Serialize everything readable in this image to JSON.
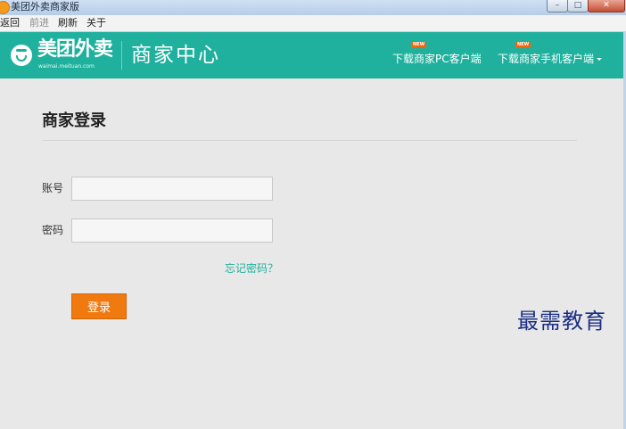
{
  "window": {
    "title": "美团外卖商家版",
    "controls": {
      "minimize": "–",
      "maximize": "□",
      "close": "✕"
    }
  },
  "menu": [
    "返回",
    "前进",
    "刷新",
    "关于"
  ],
  "header": {
    "logo_text": "美团外卖",
    "logo_url": "waimai.meituan.com",
    "section_title": "商家中心",
    "links": [
      {
        "label": "下载商家PC客户端",
        "badge": "NEW"
      },
      {
        "label": "下载商家手机客户端",
        "badge": "NEW"
      }
    ]
  },
  "login": {
    "title": "商家登录",
    "account_label": "账号",
    "account_value": "",
    "password_label": "密码",
    "password_value": "",
    "forgot_link": "忘记密码？",
    "submit_label": "登录"
  },
  "watermark": "最需教育",
  "colors": {
    "brand": "#1fb19d",
    "accent": "#f07a10"
  }
}
